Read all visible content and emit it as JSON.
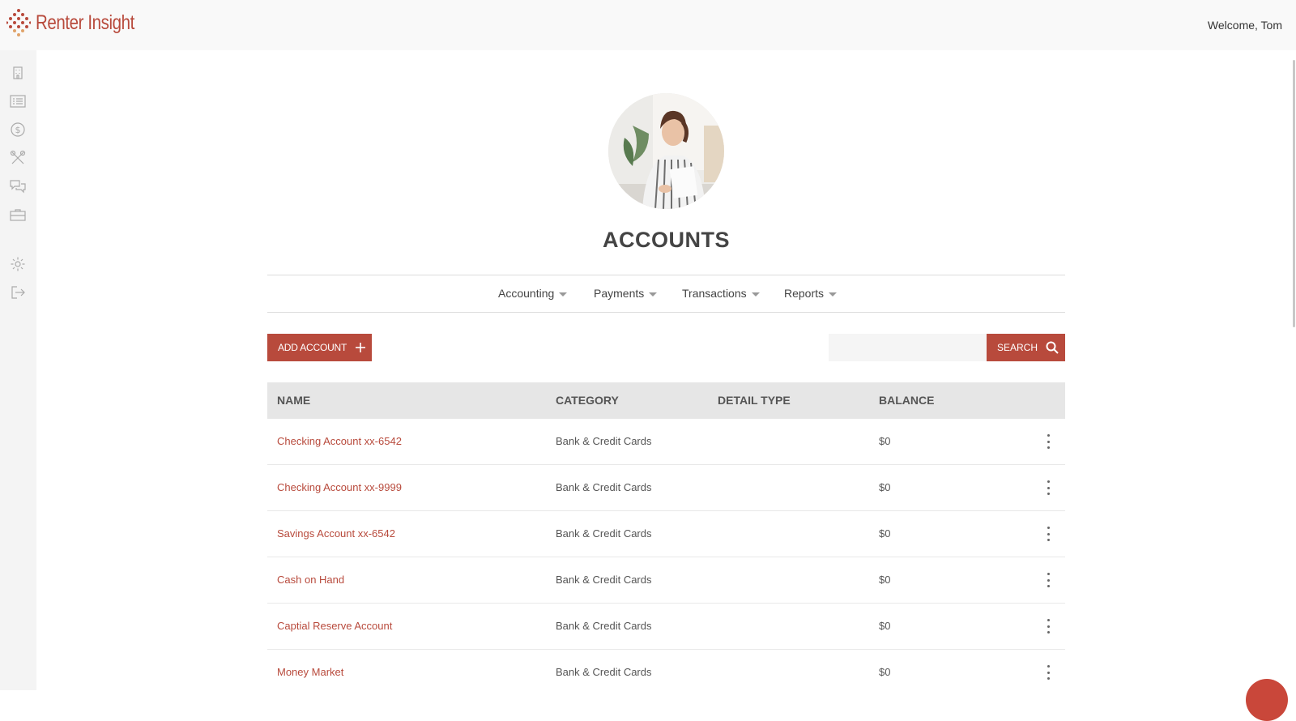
{
  "app": {
    "name": "Renter Insight",
    "welcome": "Welcome, Tom"
  },
  "sidebar": {
    "items": [
      {
        "icon": "building-icon"
      },
      {
        "icon": "list-icon"
      },
      {
        "icon": "dollar-icon"
      },
      {
        "icon": "tools-icon"
      },
      {
        "icon": "chat-icon"
      },
      {
        "icon": "briefcase-icon"
      },
      {
        "icon": "gear-icon"
      },
      {
        "icon": "logout-icon"
      }
    ]
  },
  "page": {
    "title": "ACCOUNTS"
  },
  "tabs": [
    {
      "label": "Accounting"
    },
    {
      "label": "Payments"
    },
    {
      "label": "Transactions"
    },
    {
      "label": "Reports"
    }
  ],
  "toolbar": {
    "add_label": "ADD ACCOUNT",
    "search_label": "SEARCH",
    "search_placeholder": ""
  },
  "table": {
    "columns": [
      "NAME",
      "CATEGORY",
      "DETAIL TYPE",
      "BALANCE"
    ],
    "rows": [
      {
        "name": "Checking Account xx-6542",
        "category": "Bank & Credit Cards",
        "detail": "",
        "balance": "$0"
      },
      {
        "name": "Checking Account xx-9999",
        "category": "Bank & Credit Cards",
        "detail": "",
        "balance": "$0"
      },
      {
        "name": "Savings Account xx-6542",
        "category": "Bank & Credit Cards",
        "detail": "",
        "balance": "$0"
      },
      {
        "name": "Cash on Hand",
        "category": "Bank & Credit Cards",
        "detail": "",
        "balance": "$0"
      },
      {
        "name": "Captial Reserve Account",
        "category": "Bank & Credit Cards",
        "detail": "",
        "balance": "$0"
      },
      {
        "name": "Money Market",
        "category": "Bank & Credit Cards",
        "detail": "",
        "balance": "$0"
      }
    ]
  },
  "colors": {
    "accent": "#b84a3c",
    "header_bg": "#f9f9f9",
    "table_head_bg": "#e6e6e6"
  }
}
